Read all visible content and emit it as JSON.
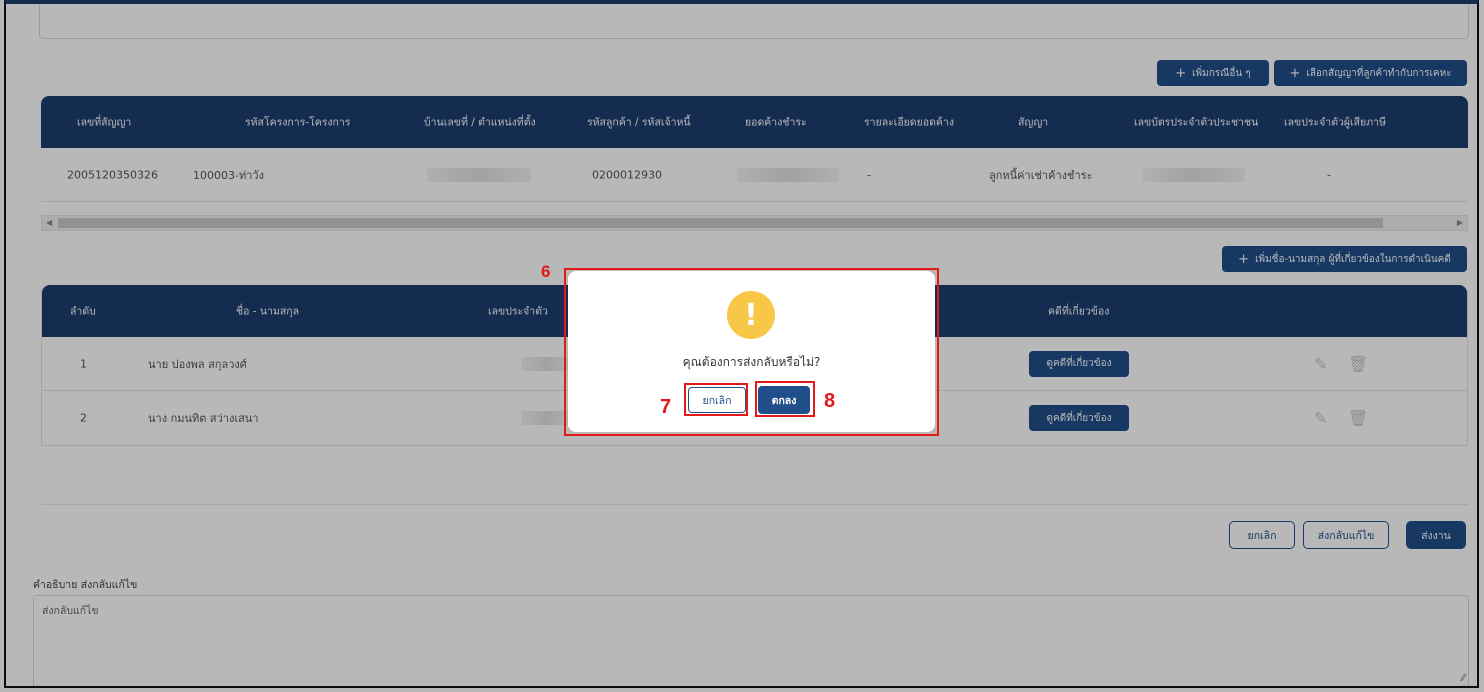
{
  "toolbar": {
    "add_other_case": "เพิ่มกรณีอื่น ๆ",
    "select_contract": "เลือกสัญญาที่ลูกค้าทำกับการเคหะ"
  },
  "contract_table": {
    "headers": [
      "เลขที่สัญญา",
      "รหัสโครงการ-โครงการ",
      "บ้านเลขที่ / ตำแหน่งที่ตั้ง",
      "รหัสลูกค้า / รหัสเจ้าหนี้",
      "ยอดค้างชำระ",
      "รายละเอียดยอดค้าง",
      "สัญญา",
      "เลขบัตรประจำตัวประชาชน",
      "เลขประจำตัวผู้เสียภาษี"
    ],
    "row": {
      "contract_no": "2005120350326",
      "project": "100003-ท่าวัง",
      "customer_code": "0200012930",
      "detail": "-",
      "contract_type": "ลูกหนี้ค่าเช่าค้างชำระ",
      "tax_id": "-"
    }
  },
  "add_person_label": "เพิ่มชื่อ-นามสกุล ผู้ที่เกี่ยวข้องในการดำเนินคดี",
  "person_table": {
    "headers": [
      "ลำดับ",
      "ชื่อ - นามสกุล",
      "เลขประจำตัว",
      "คดีที่เกี่ยวข้อง"
    ],
    "rows": [
      {
        "no": "1",
        "name": "นาย ปองพล สกุลวงศ์",
        "case_button": "ดูคดีที่เกี่ยวข้อง"
      },
      {
        "no": "2",
        "name": "นาง กมนทิต สว่างเสนา",
        "case_button": "ดูคดีที่เกี่ยวข้อง"
      }
    ]
  },
  "actions": {
    "cancel": "ยกเลิก",
    "send_back": "ส่งกลับแก้ไข",
    "submit": "ส่งงาน"
  },
  "description": {
    "label": "คำอธิบาย ส่งกลับแก้ไข",
    "value": "ส่งกลับแก้ไข"
  },
  "dialog": {
    "icon": "!",
    "message": "คุณต้องการส่งกลับหรือไม่?",
    "cancel_label": "ยกเลิก",
    "ok_label": "ตกลง"
  },
  "annotations": {
    "dialog_number": "6",
    "cancel_number": "7",
    "ok_number": "8",
    "highlight_color": "#e11919"
  },
  "colors": {
    "navy": "#1c3e70",
    "button": "#1f4e8a",
    "warning": "#f9c747"
  }
}
